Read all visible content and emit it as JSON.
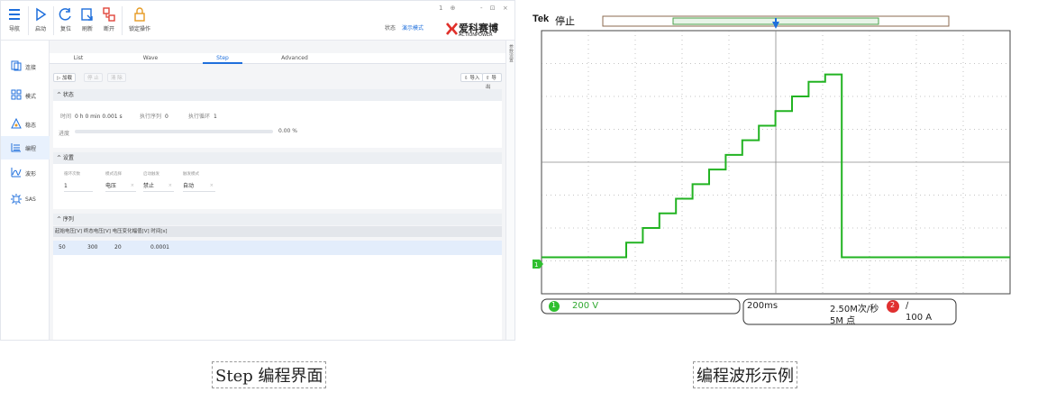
{
  "app": {
    "toolbar": {
      "nav_label": "导航",
      "start_label": "启动",
      "reset_label": "复位",
      "refresh_label": "刷新",
      "disconnect_label": "断开",
      "lock_label": "锁定操作",
      "status_label": "状态",
      "status_mode": "演示模式",
      "window_controls": "1 ⊕",
      "window_controls2": "- ⊡ ×",
      "logo_cn": "爱科赛博",
      "logo_en": "ACTIONPOWER"
    },
    "sidebar": {
      "items": [
        {
          "label": "连接",
          "icon": "connect-icon"
        },
        {
          "label": "模式",
          "icon": "grid-icon"
        },
        {
          "label": "稳态",
          "icon": "triangle-icon"
        },
        {
          "label": "编程",
          "icon": "list-icon"
        },
        {
          "label": "波形",
          "icon": "wave-icon"
        },
        {
          "label": "SAS",
          "icon": "sun-icon"
        }
      ],
      "active_index": 3
    },
    "tabs": [
      "List",
      "Wave",
      "Step",
      "Advanced"
    ],
    "active_tab": "Step",
    "actions": {
      "run": "▷ 加载",
      "stop": "停 止",
      "clear": "清 除",
      "import": "⇩ 导入",
      "export": "⇧ 导出"
    },
    "right_strip": "参数设置",
    "status_section": {
      "title": "^ 状态",
      "time_label": "时间",
      "time_value": "0 h 0 min 0.001 s",
      "seq_label": "执行序列",
      "seq_value": "0",
      "loop_label": "执行循环",
      "loop_value": "1",
      "progress_label": "进度",
      "progress_fraction": 0.0,
      "progress_text": "0.00 %"
    },
    "settings_section": {
      "title": "^ 设置",
      "fields": [
        {
          "label": "循环次数",
          "value": "1"
        },
        {
          "label": "模式选择",
          "value": "电压"
        },
        {
          "label": "启动触发",
          "value": "禁止"
        },
        {
          "label": "触发模式",
          "value": "自动"
        }
      ]
    },
    "sequence_section": {
      "title": "^ 序列",
      "columns": [
        "起始电压[V]",
        "终态电压[V]",
        "电压变化幅值[V]",
        "时间[s]"
      ],
      "header_text": "起始电压[V] 终态电压[V] 电压变化幅值[V] 时间[s]",
      "rows": [
        [
          "50",
          "300",
          "20",
          "0.0001"
        ]
      ]
    }
  },
  "scope": {
    "brand": "Tek",
    "state": "停止",
    "trigger_marker": "T",
    "ch1_marker": "1",
    "ch1_scale": "200 V",
    "timebase": "200ms",
    "sample_rate": "2.50M次/秒",
    "record_length": "5M 点",
    "ch2_badge": "2",
    "ch2_slope": "∕",
    "ch2_level": "100 A",
    "colors": {
      "trace": "#22b322",
      "grid": "#8a8a8a",
      "frame": "#222222"
    },
    "waveform": {
      "description_steps": [
        50,
        70,
        90,
        110,
        130,
        150,
        170,
        190,
        210,
        230,
        250,
        270,
        290,
        300,
        50
      ]
    }
  },
  "captions": {
    "left": "Step 编程界面",
    "right": "编程波形示例"
  }
}
